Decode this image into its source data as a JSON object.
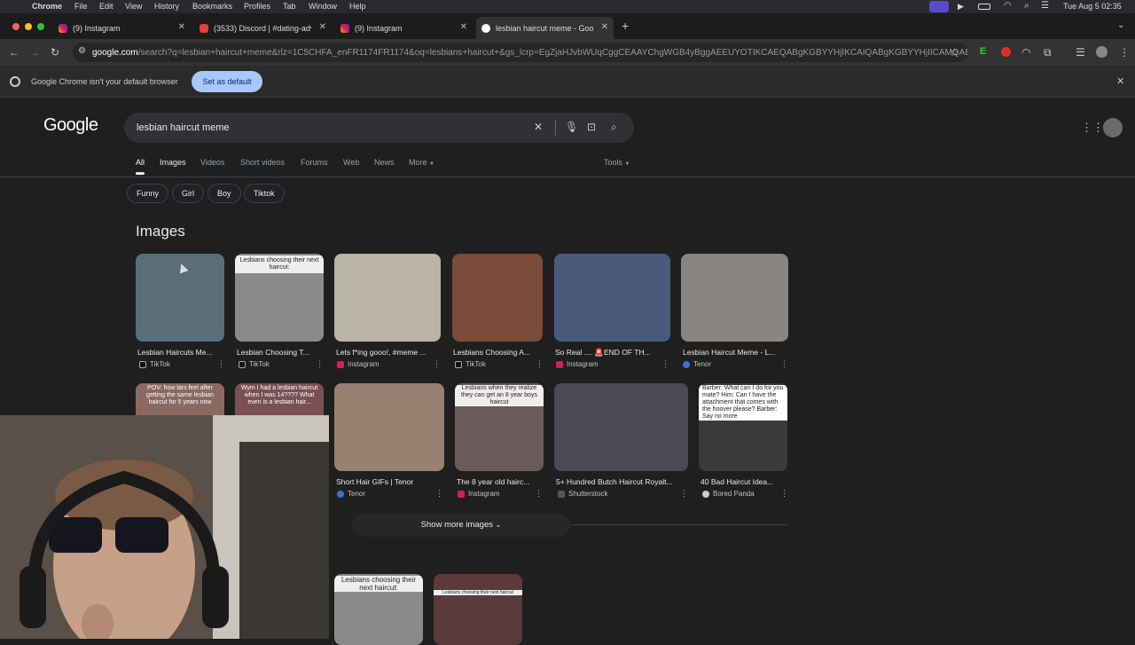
{
  "menubar": {
    "app": "Chrome",
    "items": [
      "File",
      "Edit",
      "View",
      "History",
      "Bookmarks",
      "Profiles",
      "Tab",
      "Window",
      "Help"
    ],
    "clock": "Tue Aug 5  02:35"
  },
  "tabs": [
    {
      "title": "(9) Instagram",
      "icon": "instagram-icon"
    },
    {
      "title": "(3533) Discord | #dating-adv",
      "icon": "discord-icon"
    },
    {
      "title": "(9) Instagram",
      "icon": "instagram-icon"
    },
    {
      "title": "lesbian haircut meme - Goog",
      "icon": "google-icon"
    }
  ],
  "address": {
    "host": "google.com",
    "path": "/search?q=lesbian+haircut+meme&rlz=1C5CHFA_enFR1174FR1174&oq=lesbians+haircut+&gs_lcrp=EgZjaHJvbWUqCggCEAAYChgWGB4yBggAEEUYOTIKCAEQABgKGBYYHjIKCAIQABgKGBYYHjIICAMQAB..."
  },
  "infobar": {
    "message": "Google Chrome isn't your default browser",
    "button": "Set as default"
  },
  "google": {
    "logo": "Google",
    "query": "lesbian haircut meme",
    "tabs": [
      "All",
      "Images",
      "Videos",
      "Short videos",
      "Forums",
      "Web",
      "News",
      "More"
    ],
    "tools": "Tools",
    "chips": [
      "Funny",
      "Girl",
      "Boy",
      "Tiktok"
    ],
    "images_heading": "Images",
    "row1": [
      {
        "caption": "Lesbian Haircuts Me...",
        "source": "TikTok",
        "overlay": "",
        "color": "#5a6e7a"
      },
      {
        "caption": "Lesbian Choosing T...",
        "source": "TikTok",
        "overlay": "Lesbians choosing their next haircut:",
        "color": "#8a8a8a"
      },
      {
        "caption": "Lets f*ing gooo!, #meme ...",
        "source": "Instagram",
        "overlay": "",
        "color": "#b9b3a8"
      },
      {
        "caption": "Lesbians Choosing A...",
        "source": "TikTok",
        "overlay": "",
        "color": "#7a4a3a"
      },
      {
        "caption": "So Real .... 🚨END OF TH...",
        "source": "Instagram",
        "overlay": "",
        "color": "#4a5a7a"
      },
      {
        "caption": "Lesbian Haircut Meme - L...",
        "source": "Tenor",
        "overlay": "",
        "color": "#8a8580"
      }
    ],
    "row2": [
      {
        "caption": "",
        "source": "",
        "overlay": "POV: how lars feel after getting the same lesbian haircut for 5 years now",
        "color": "#8a6a60"
      },
      {
        "caption": "",
        "source": "",
        "overlay": "Wym I had a lesbian haircut when I was 14???? What even is a lesbian hair...",
        "color": "#7a5055"
      },
      {
        "caption": "Short Hair GIFs | Tenor",
        "source": "Tenor",
        "overlay": "",
        "color": "#9a8070"
      },
      {
        "caption": "The 8 year old hairc...",
        "source": "Instagram",
        "overlay": "Lesbians when they realize they can get an 8 year boys haircut",
        "color": "#6a5a5a"
      },
      {
        "caption": "5+ Hundred Butch Haircut Royalt...",
        "source": "Shutterstock",
        "overlay": "",
        "color": "#4a4a55"
      },
      {
        "caption": "40 Bad Haircut Idea...",
        "source": "Bored Panda",
        "overlay": "Barber: What can I do for you mate? Him: Can I have the attachment that comes with the hoover please? Barber: Say no more",
        "color": "#3a3a3a"
      }
    ],
    "show_more": "Show more images",
    "row3": [
      {
        "overlay": "Lesbians choosing their next haircut:",
        "color": "#8a8a8a"
      },
      {
        "overlay": "Lesbians choosing their next haircut",
        "color": "#5a3a3a"
      }
    ]
  }
}
